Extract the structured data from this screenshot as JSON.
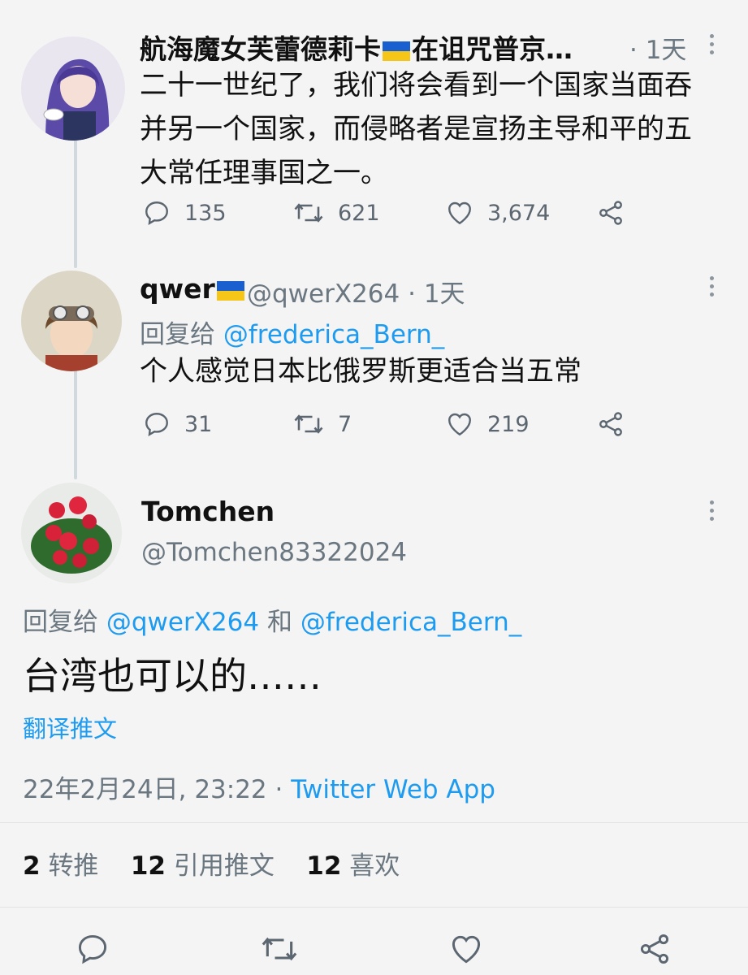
{
  "tweets": [
    {
      "name": "航海魔女芙蕾德莉卡",
      "name_suffix": "在诅咒普京…",
      "time": "· 1天",
      "text_lines": [
        "二十一世纪了，我们将会看到一个国家当面吞",
        "并另一个国家，而侵略者是宣扬主导和平的五",
        "大常任理事国之一。"
      ],
      "replies": "135",
      "retweets": "621",
      "likes": "3,674"
    },
    {
      "name": "qwer",
      "handle_time": "@qwerX264 · 1天",
      "reply_prefix": "回复给",
      "reply_to": "@frederica_Bern_",
      "text": "个人感觉日本比俄罗斯更适合当五常",
      "replies": "31",
      "retweets": "7",
      "likes": "219"
    }
  ],
  "main_tweet": {
    "name": "Tomchen",
    "handle": "@Tomchen83322024",
    "reply_prefix": "回复给",
    "reply_to_1": "@qwerX264",
    "reply_and": "和",
    "reply_to_2": "@frederica_Bern_",
    "text": "台湾也可以的……",
    "translate": "翻译推文",
    "timestamp": "22年2月24日, 23:22 ·",
    "source": "Twitter Web App",
    "stats": {
      "retweets_num": "2",
      "retweets_label": "转推",
      "quotes_num": "12",
      "quotes_label": "引用推文",
      "likes_num": "12",
      "likes_label": "喜欢"
    }
  },
  "colors": {
    "background": "#f4f4f4",
    "link": "#1d9bf0",
    "muted": "#6b7780",
    "flag_blue": "#1a5fd0",
    "flag_yellow": "#f5c518"
  },
  "icons": [
    "reply-icon",
    "retweet-icon",
    "like-icon",
    "share-icon",
    "more-icon",
    "ukraine-flag-icon"
  ]
}
